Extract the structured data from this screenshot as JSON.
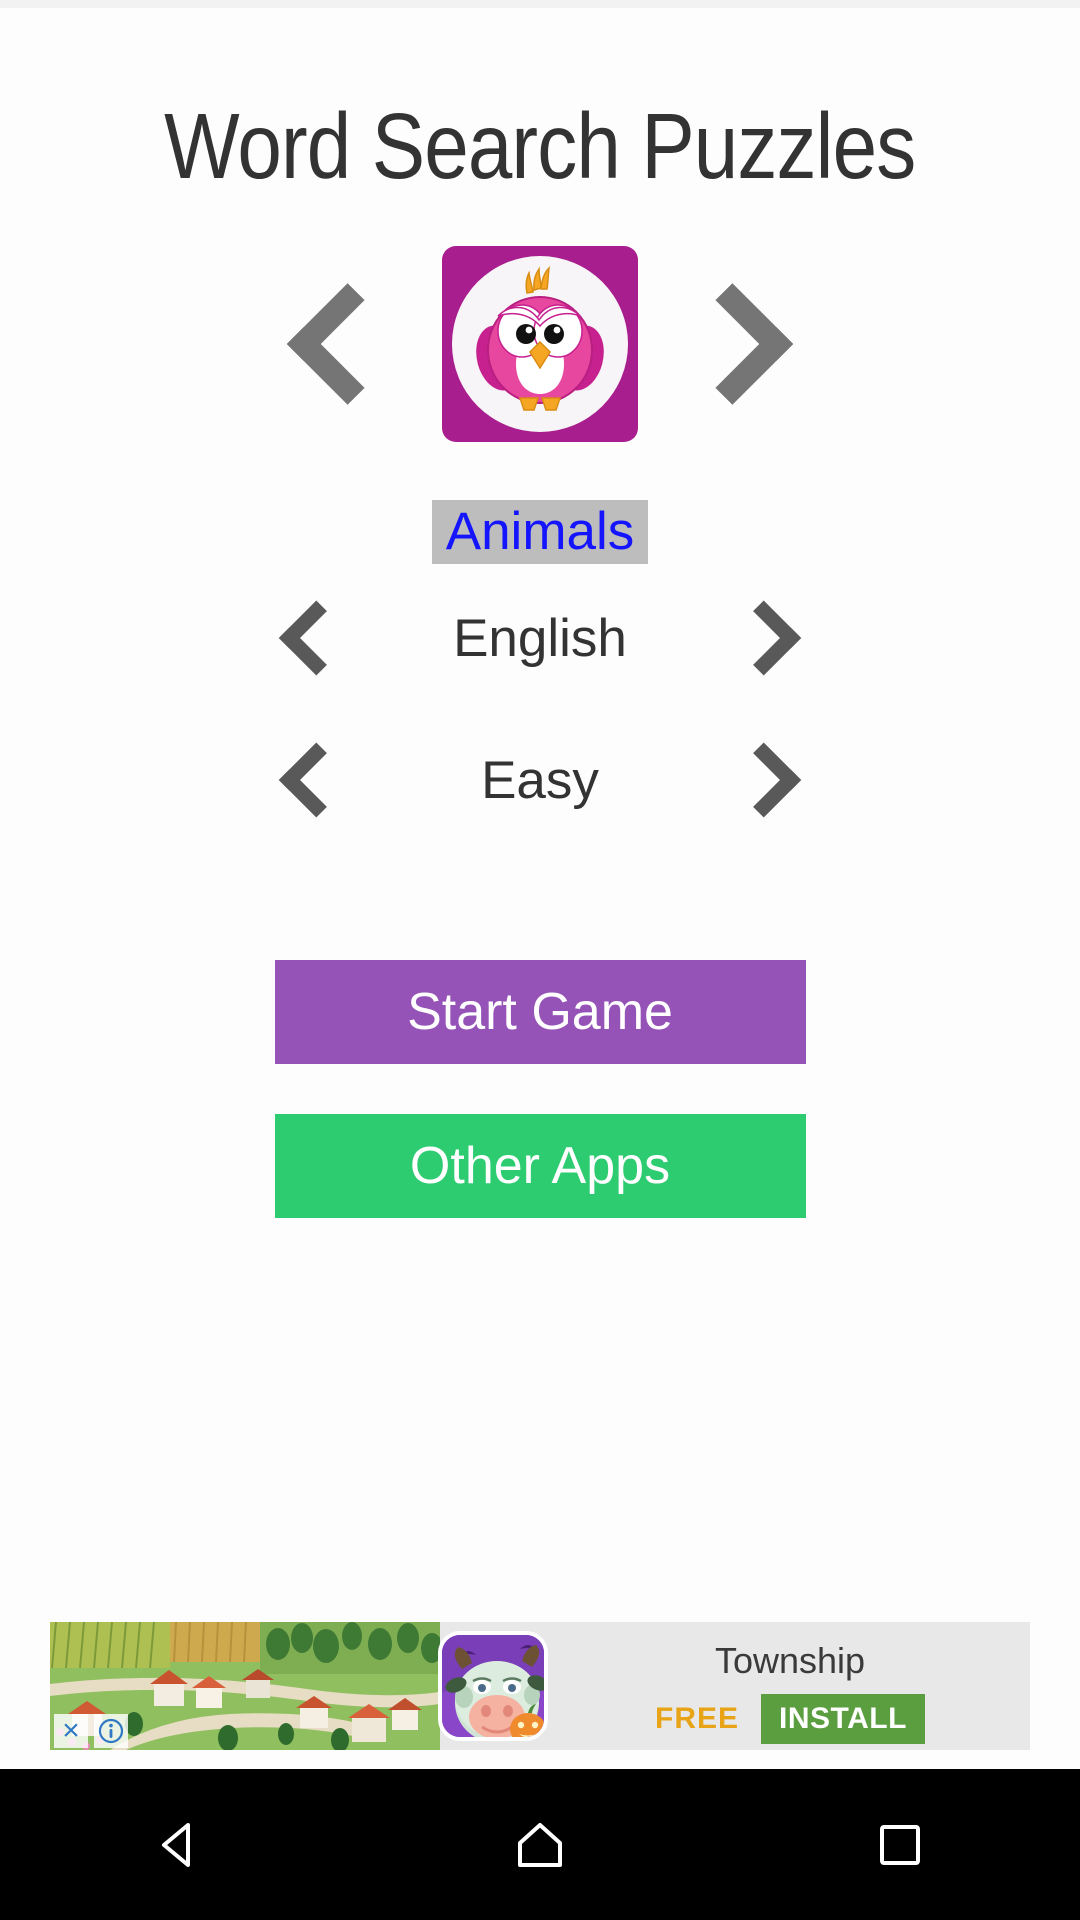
{
  "app": {
    "title": "Word Search Puzzles",
    "background_color": "#fdfdfd"
  },
  "category_selector": {
    "prev_label": "‹",
    "next_label": "›",
    "icon_name": "pink-bird-icon",
    "icon_background_color": "#A81E8E",
    "selected": "Animals",
    "selected_text_color": "#1414ff",
    "selected_highlight_color": "#bdbdbd"
  },
  "language_selector": {
    "label": "English",
    "prev_name": "language-prev-arrow",
    "next_name": "language-next-arrow"
  },
  "difficulty_selector": {
    "label": "Easy",
    "prev_name": "difficulty-prev-arrow",
    "next_name": "difficulty-next-arrow"
  },
  "buttons": {
    "start_game": "Start Game",
    "start_game_color": "#9553b8",
    "other_apps": "Other Apps",
    "other_apps_color": "#2ecc71"
  },
  "ad": {
    "app_name": "Township",
    "price": "FREE",
    "install": "INSTALL",
    "install_color": "#5a9e3f",
    "price_color": "#e8a317",
    "close_icon": "×",
    "info_icon": "i",
    "background_color": "#e8e8e8"
  },
  "nav_bar": {
    "back": "back-triangle-icon",
    "home": "home-icon",
    "recents": "recents-square-icon",
    "background_color": "#000000"
  }
}
